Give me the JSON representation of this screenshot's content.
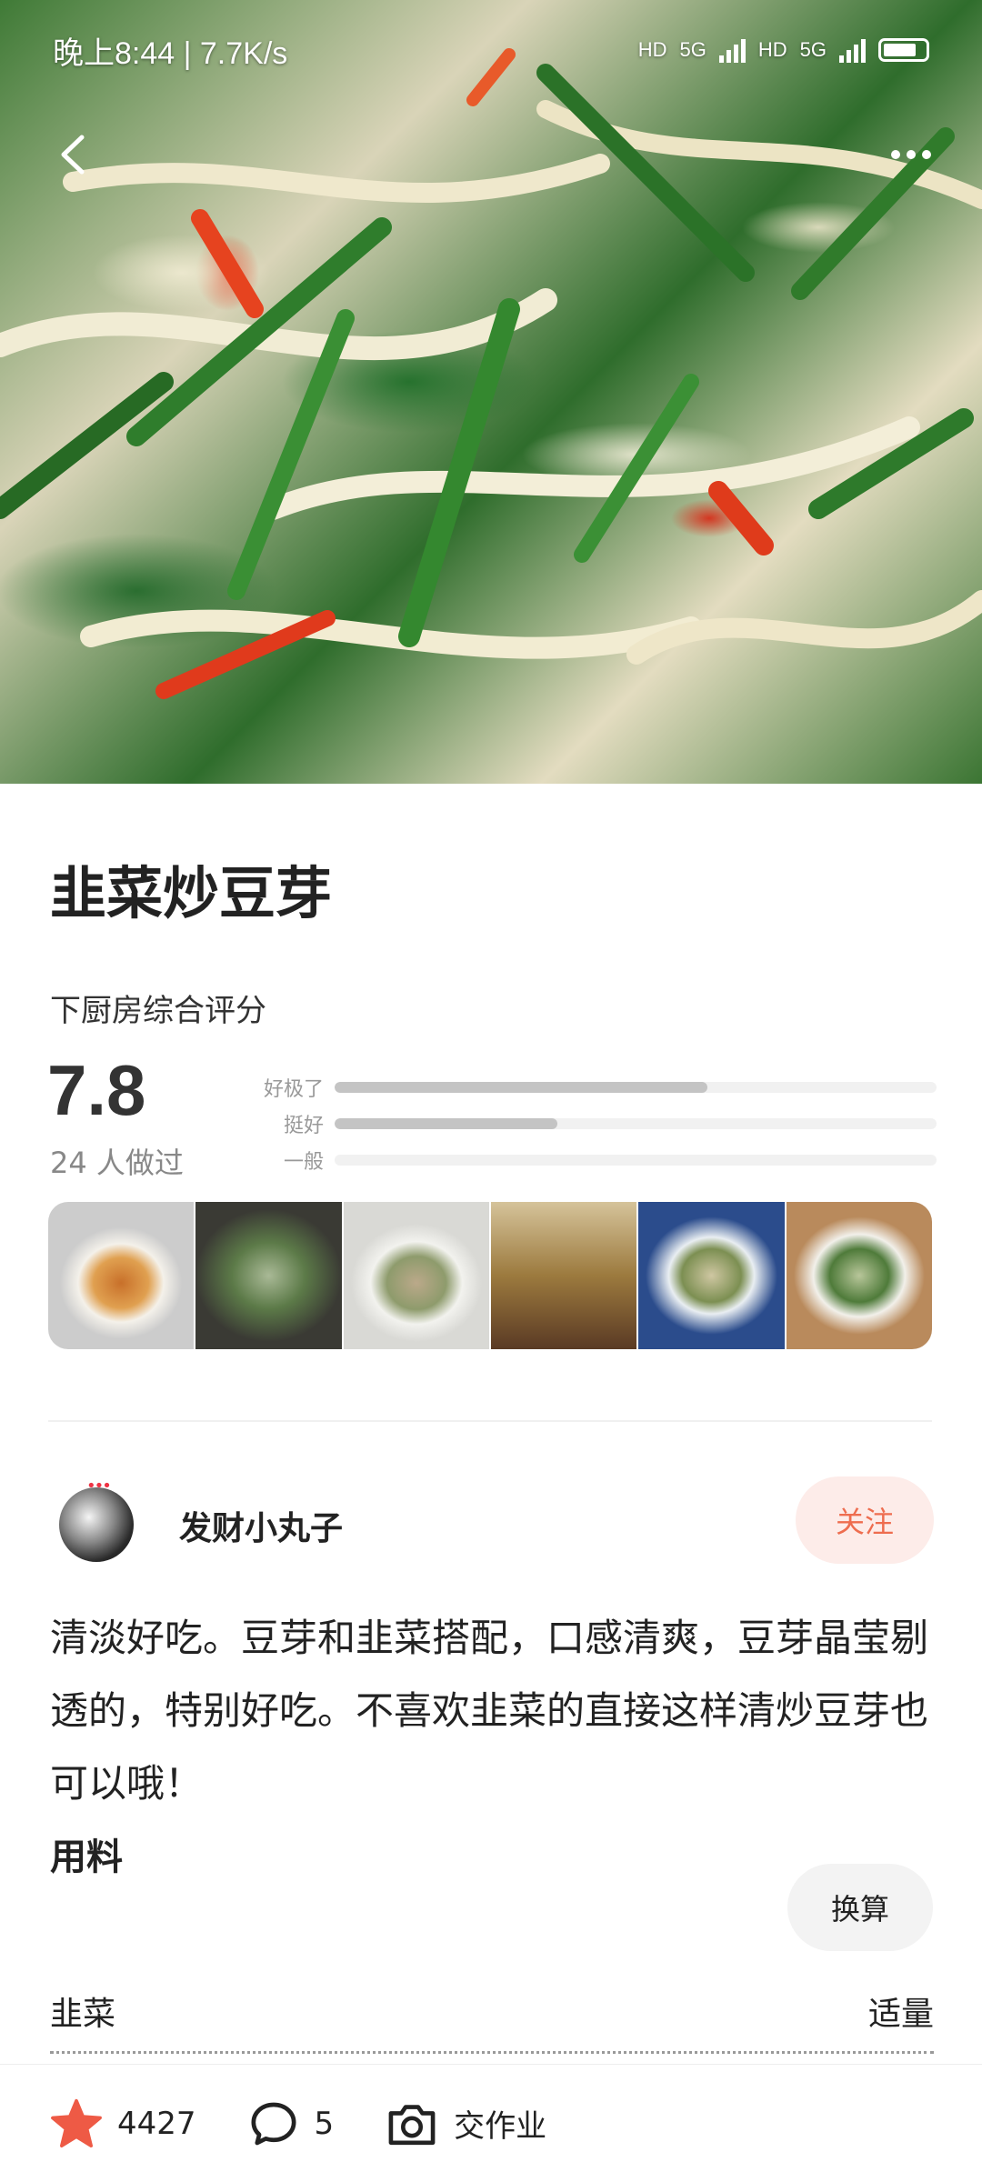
{
  "status_bar": {
    "time_speed": "晚上8:44 | 7.7K/s",
    "network_label_1": "5G",
    "network_label_2": "5G",
    "hd_label_1": "HD",
    "hd_label_2": "HD"
  },
  "hero": {
    "back_icon": "chevron-left-icon",
    "more_icon": "more-horizontal-icon"
  },
  "recipe": {
    "title": "韭菜炒豆芽",
    "rating_label": "下厨房综合评分",
    "score": "7.8",
    "cooked_count": "24 人做过",
    "rating_bars": [
      {
        "label": "好极了",
        "fraction": 0.62
      },
      {
        "label": "挺好",
        "fraction": 0.37
      },
      {
        "label": "一般",
        "fraction": 0.0
      }
    ]
  },
  "author": {
    "name": "发财小丸子",
    "follow_label": "关注"
  },
  "description": "清淡好吃。豆芽和韭菜搭配，口感清爽，豆芽晶莹剔透的，特别好吃。不喜欢韭菜的直接这样清炒豆芽也可以哦！",
  "ingredients": {
    "title": "用料",
    "convert_label": "换算",
    "items": [
      {
        "name": "韭菜",
        "amount": "适量"
      }
    ]
  },
  "bottom_bar": {
    "favorites_count": "4427",
    "comments_count": "5",
    "homework_label": "交作业"
  },
  "colors": {
    "accent": "#ee6d4f",
    "star": "#ee5a45"
  }
}
